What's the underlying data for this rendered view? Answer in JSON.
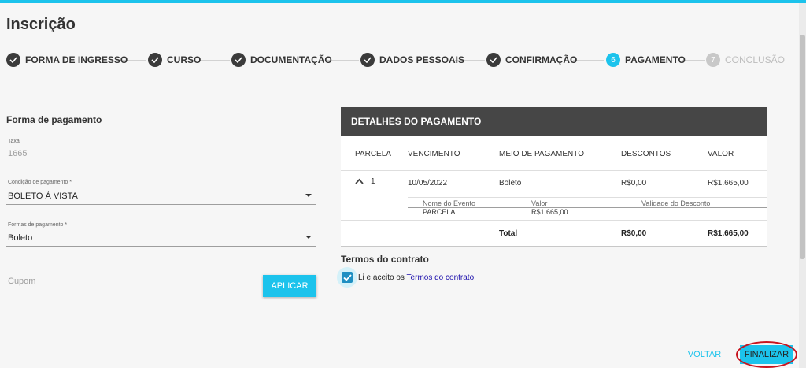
{
  "page": {
    "title": "Inscrição"
  },
  "steps": [
    {
      "number": "1",
      "label": "FORMA DE INGRESSO",
      "state": "done"
    },
    {
      "number": "2",
      "label": "CURSO",
      "state": "done"
    },
    {
      "number": "3",
      "label": "DOCUMENTAÇÃO",
      "state": "done"
    },
    {
      "number": "4",
      "label": "DADOS PESSOAIS",
      "state": "done"
    },
    {
      "number": "5",
      "label": "CONFIRMAÇÃO",
      "state": "done"
    },
    {
      "number": "6",
      "label": "PAGAMENTO",
      "state": "active"
    },
    {
      "number": "7",
      "label": "CONCLUSÃO",
      "state": "pending"
    }
  ],
  "form": {
    "title": "Forma de pagamento",
    "taxa": {
      "label": "Taxa",
      "value": "1665"
    },
    "condicao": {
      "label": "Condição de pagamento *",
      "value": "BOLETO À VISTA"
    },
    "formas": {
      "label": "Formas de pagamento *",
      "value": "Boleto"
    },
    "cupom": {
      "placeholder": "Cupom",
      "value": ""
    },
    "apply_label": "APLICAR"
  },
  "payment": {
    "header": "DETALHES DO PAGAMENTO",
    "columns": [
      "PARCELA",
      "VENCIMENTO",
      "MEIO DE PAGAMENTO",
      "DESCONTOS",
      "VALOR"
    ],
    "row": {
      "parcela": "1",
      "vencimento": "10/05/2022",
      "meio": "Boleto",
      "descontos": "R$0,00",
      "valor": "R$1.665,00"
    },
    "sub_columns": [
      "Nome do Evento",
      "Valor",
      "Validade do Desconto"
    ],
    "sub_row": {
      "evento": "PARCELA",
      "valor": "R$1.665,00",
      "validade": ""
    },
    "total": {
      "label": "Total",
      "descontos": "R$0,00",
      "valor": "R$1.665,00"
    }
  },
  "terms": {
    "title": "Termos do contrato",
    "text": "Li e aceito os",
    "link": "Termos do contrato",
    "checked": true
  },
  "actions": {
    "back": "VOLTAR",
    "finish": "FINALIZAR"
  },
  "colors": {
    "accent": "#1cc3ec",
    "header": "#464646",
    "highlight": "#c8141e"
  }
}
